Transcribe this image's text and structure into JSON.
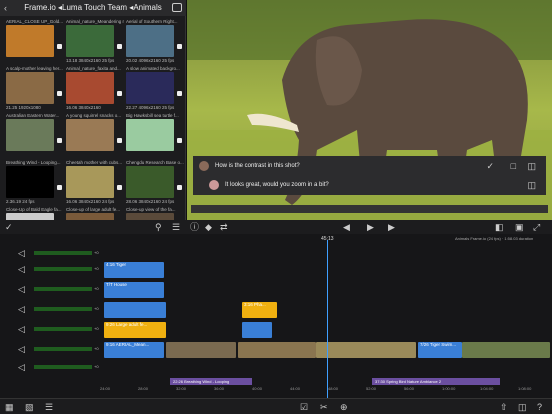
{
  "browser": {
    "title": "Frame.io ◂Luma Touch Team ◂Animals",
    "clips": [
      {
        "title": "AERIAL_CLOSE UP_Gold...",
        "meta": "",
        "color": "#c07a2a"
      },
      {
        "title": "Animal_nature_Meandering river...",
        "meta": "13.18  3840x2160  25 fps",
        "color": "#3b6a3a"
      },
      {
        "title": "Aerial of Southern Right...",
        "meta": "20.02  4096x2160  25 fps",
        "color": "#4d6f86"
      },
      {
        "title": "A scalp-mother leaving her...",
        "meta": "21.25  1920x1080",
        "color": "#8a6a45"
      },
      {
        "title": "Animal_nature_faxita and...",
        "meta": "16.06  3840x2160",
        "color": "#a84a30"
      },
      {
        "title": "A slow animated backgro...",
        "meta": "22.27  4096x2160  25 fps",
        "color": "#2a2a5a"
      },
      {
        "title": "Australian Eastern Water...",
        "meta": "",
        "color": "#6a7a5a"
      },
      {
        "title": "A young squirrel snacks o...",
        "meta": "",
        "color": "#9a7a55"
      },
      {
        "title": "Big Hawksbill sea turtle f...",
        "meta": "",
        "color": "#9acba0"
      },
      {
        "title": "Breathing Wind - Looping...",
        "meta": "2.36.19  24 fps",
        "color": "#000000"
      },
      {
        "title": "Cheetah mother with cubs...",
        "meta": "16.06  3840x2160  24 fps",
        "color": "#a8985a"
      },
      {
        "title": "Chengdu Research Base o...",
        "meta": "28.06  3840x2160  24 fps",
        "color": "#3a5a2a"
      },
      {
        "title": "Close-Up of Bald Eagle fa...",
        "meta": "",
        "color": "#cccccc"
      },
      {
        "title": "Close-up of large adult fe...",
        "meta": "",
        "color": "#7a5a3a"
      },
      {
        "title": "Close-up view of the fa...",
        "meta": "",
        "color": "#5a4a3a"
      }
    ]
  },
  "viewer": {
    "comments": [
      {
        "text": "How is the contrast in this shot?"
      },
      {
        "text": "It looks great, would you zoom in a bit?"
      }
    ]
  },
  "timeline": {
    "timecode": "45:13",
    "project": "Animals Frame.io (24 fps) · 1:58.03 duration",
    "ruler": [
      "24:00",
      "28:00",
      "32:00",
      "36:00",
      "40:00",
      "44:00",
      "48:00",
      "52:00",
      "56:00",
      "1:00:00",
      "1:04:00",
      "1:08:00"
    ],
    "clips_row2": [
      "T/T  House",
      "9:16 AERIAL_Mean...",
      "7/26 Tiger Swim..."
    ],
    "clips_row1": [
      "4:16 Tiger"
    ],
    "clips_row3": [
      "9:26 Large adult fe...",
      "3:16 Pha..."
    ],
    "audio1": "22:26  Breathing Wind - Looping",
    "audio2": "37:30  Spring Bird Nature Ambiance 2",
    "label_plus": "+0"
  }
}
